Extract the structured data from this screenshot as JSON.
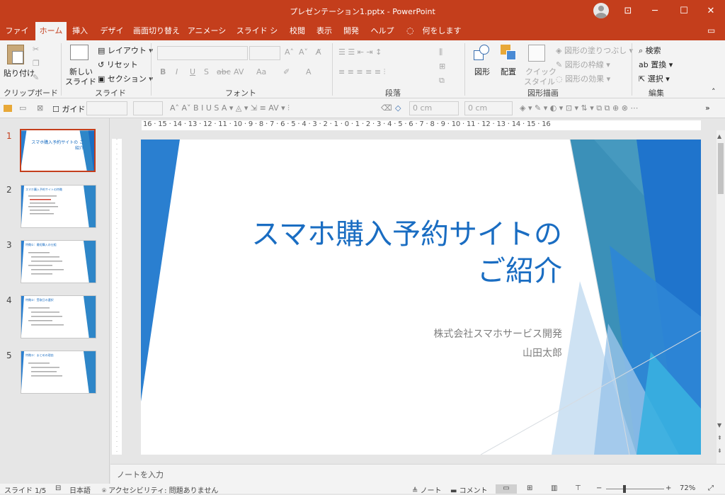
{
  "window": {
    "title": "プレゼンテーション1.pptx  -  PowerPoint",
    "minimize": "─",
    "maximize": "☐",
    "close": "✕",
    "restore_ribbon": "⊡"
  },
  "tabs": [
    "ファイル",
    "ホーム",
    "挿入",
    "デザイン",
    "画面切り替え",
    "アニメーション",
    "スライド ショー",
    "校閲",
    "表示",
    "開発",
    "ヘルプ",
    "何をしますか"
  ],
  "ribbon": {
    "clipboard": {
      "paste": "貼り付け",
      "label": "クリップボード"
    },
    "slides": {
      "new_slide_1": "新しい",
      "new_slide_2": "スライド",
      "layout": "レイアウト",
      "reset": "リセット",
      "section": "セクション",
      "label": "スライド"
    },
    "font": {
      "label": "フォント"
    },
    "paragraph": {
      "label": "段落"
    },
    "drawing": {
      "shapes": "図形",
      "arrange": "配置",
      "quick_1": "クイック",
      "quick_2": "スタイル",
      "fill": "図形の塗りつぶし",
      "outline": "図形の枠線",
      "effects": "図形の効果",
      "label": "図形描画"
    },
    "editing": {
      "find": "検索",
      "replace": "置換",
      "select": "選択",
      "label": "編集"
    }
  },
  "qat": {
    "guide": "ガイド",
    "size1": "0 cm",
    "size2": "0 cm"
  },
  "ruler": {
    "h": "16 · 15 · 14 · 13 · 12 · 11 · 10 · 9 · 8 · 7 · 6 · 5 · 4 · 3 · 2 · 1 · 0 · 1 · 2 · 3 · 4 · 5 · 6 · 7 · 8 · 9 · 10 · 11 · 12 · 13 · 14 · 15 · 16"
  },
  "thumbnails": [
    {
      "num": "1",
      "title": "スマホ購入予約サイトの ご紹介"
    },
    {
      "num": "2",
      "title": "スマホ購入予約サイトの特徴"
    },
    {
      "num": "3",
      "title": "特徴①：最短購入の仕組"
    },
    {
      "num": "4",
      "title": "特徴②：受取日の選択"
    },
    {
      "num": "5",
      "title": "特徴③：まとめの理由"
    }
  ],
  "slide": {
    "title_line1": "スマホ購入予約サイトの",
    "title_line2": "ご紹介",
    "subtitle_line1": "株式会社スマホサービス開発",
    "subtitle_line2": "山田太郎"
  },
  "notes": {
    "placeholder": "ノートを入力"
  },
  "status": {
    "slide": "スライド 1/5",
    "lang": "日本語",
    "accessibility": "アクセシビリティ: 問題ありません",
    "notes": "ノート",
    "comments": "コメント",
    "zoom": "72%"
  },
  "colors": {
    "accent": "#c43e1c",
    "slide_blue": "#2276c9"
  }
}
